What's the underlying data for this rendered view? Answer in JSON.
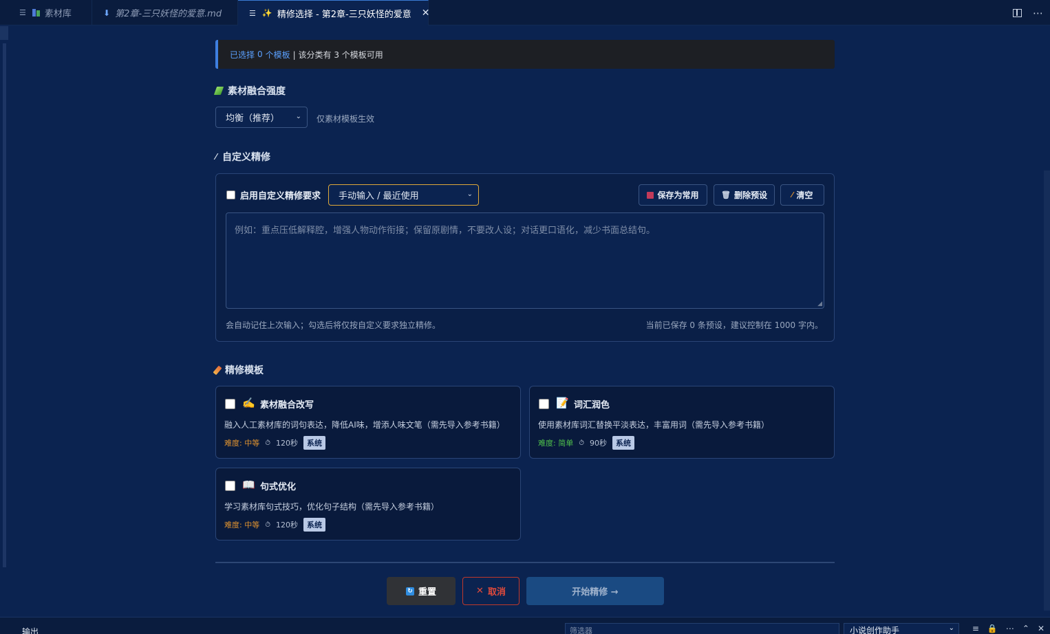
{
  "tabs": [
    {
      "label": "素材库",
      "icon": "library-icon",
      "italic": false,
      "active": false
    },
    {
      "label": "第2章-三只妖怪的爱意.md",
      "icon": "markdown-download-icon",
      "italic": true,
      "active": false
    },
    {
      "label": "精修选择 - 第2章-三只妖怪的爱意",
      "icon": "sparkle-icon",
      "italic": false,
      "active": true
    }
  ],
  "info_bar": {
    "prefix": "已选择",
    "count": "0",
    "unit": "个模板",
    "suffix": "| 该分类有 3 个模板可用"
  },
  "fusion": {
    "title": "素材融合强度",
    "select_value": "均衡（推荐）",
    "hint": "仅素材模板生效"
  },
  "custom": {
    "title": "自定义精修",
    "enable_label": "启用自定义精修要求",
    "enabled": false,
    "preset_select": "手动输入 / 最近使用",
    "save_btn": "保存为常用",
    "delete_btn": "删除预设",
    "clear_btn": "清空",
    "placeholder": "例如：重点压低解释腔，增强人物动作衔接；保留原剧情，不要改人设；对话更口语化，减少书面总结句。",
    "note_left": "会自动记住上次输入；勾选后将仅按自定义要求独立精修。",
    "note_right": "当前已保存 0 条预设，建议控制在 1000 字内。"
  },
  "templates": {
    "title": "精修模板",
    "items": [
      {
        "name": "素材融合改写",
        "icon": "hand-write-icon",
        "desc": "融入人工素材库的词句表达，降低AI味，增添人味文笔（需先导入参考书籍）",
        "difficulty": "难度: 中等",
        "time": "120秒",
        "tag": "系统"
      },
      {
        "name": "词汇润色",
        "icon": "memo-icon",
        "desc": "使用素材库词汇替换平淡表达，丰富用词（需先导入参考书籍）",
        "difficulty": "难度: 简单",
        "time": "90秒",
        "tag": "系统"
      },
      {
        "name": "句式优化",
        "icon": "book-icon",
        "desc": "学习素材库句式技巧，优化句子结构（需先导入参考书籍）",
        "difficulty": "难度: 中等",
        "time": "120秒",
        "tag": "系统"
      }
    ]
  },
  "actions": {
    "reset": "重置",
    "cancel": "取消",
    "start": "开始精修 →"
  },
  "bottom_panel": {
    "output_label": "输出",
    "filter_placeholder": "筛选器",
    "channel": "小说创作助手"
  },
  "colors": {
    "background": "#0b2350",
    "accent": "#3f7fe0",
    "difficulty_medium": "#e0932f",
    "difficulty_easy": "#4fc04b",
    "cancel_red": "#e24a3b"
  }
}
